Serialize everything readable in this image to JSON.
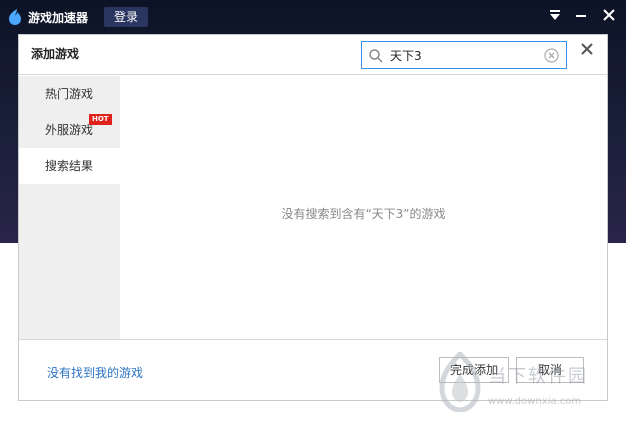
{
  "app": {
    "title": "游戏加速器",
    "login_label": "登录"
  },
  "dialog": {
    "title": "添加游戏",
    "search": {
      "value": "天下3"
    },
    "sidebar": {
      "items": [
        {
          "label": "热门游戏"
        },
        {
          "label": "外服游戏",
          "badge": "HOT"
        },
        {
          "label": "搜索结果"
        }
      ]
    },
    "empty_message": "没有搜索到含有“天下3”的游戏",
    "footer": {
      "not_found_link": "没有找到我的游戏",
      "done_label": "完成添加",
      "cancel_label": "取消"
    }
  },
  "watermark": {
    "title": "当下软件园",
    "url": "www.downxia.com"
  },
  "colors": {
    "accent": "#3a8ee6",
    "link": "#2b73c4",
    "hot": "#e0231a",
    "header_bg": "#0d1326"
  }
}
